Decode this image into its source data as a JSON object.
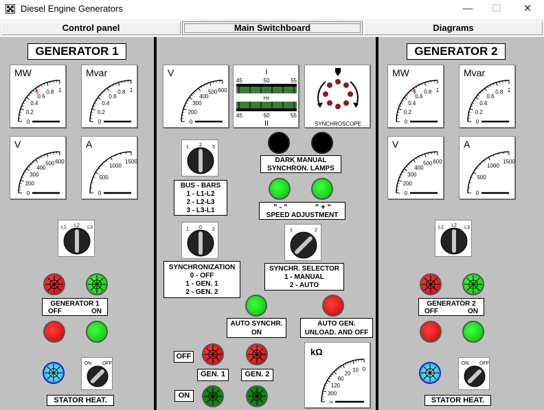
{
  "window": {
    "title": "Diesel Engine Generators",
    "minimize": "—",
    "maximize": "☐",
    "close": "✕"
  },
  "tabs": [
    {
      "label": "Control panel"
    },
    {
      "label": "Main Switchboard"
    },
    {
      "label": "Diagrams"
    }
  ],
  "gen1": {
    "title": "GENERATOR 1",
    "mw": {
      "unit": "MW",
      "ticks": [
        "0",
        "0.2",
        "0.4",
        "0.6",
        "0.8",
        "1"
      ]
    },
    "mvar": {
      "unit": "Mvar",
      "ticks": [
        "0",
        "0.2",
        "0.4",
        "0.6",
        "0.8",
        "1"
      ]
    },
    "volt": {
      "unit": "V",
      "ticks": [
        "0",
        "200",
        "300",
        "400",
        "500",
        "600"
      ]
    },
    "amp": {
      "unit": "A",
      "ticks": [
        "0",
        "500",
        "1000",
        "1500"
      ]
    },
    "phase_selector": {
      "l1": "L1",
      "l2": "L2",
      "l3": "L3"
    },
    "switch_label": {
      "name": "GENERATOR 1",
      "off": "OFF",
      "on": "ON"
    },
    "heater": {
      "on": "ON",
      "off": "OFF",
      "label": "STATOR  HEAT."
    }
  },
  "gen2": {
    "title": "GENERATOR 2",
    "mw": {
      "unit": "MW",
      "ticks": [
        "0",
        "0.2",
        "0.4",
        "0.6",
        "0.8",
        "1"
      ]
    },
    "mvar": {
      "unit": "Mvar",
      "ticks": [
        "0",
        "0.2",
        "0.4",
        "0.6",
        "0.8",
        "1"
      ]
    },
    "volt": {
      "unit": "V",
      "ticks": [
        "0",
        "200",
        "300",
        "400",
        "500",
        "600"
      ]
    },
    "amp": {
      "unit": "A",
      "ticks": [
        "0",
        "500",
        "1000",
        "1500"
      ]
    },
    "phase_selector": {
      "l1": "L1",
      "l2": "L2",
      "l3": "L3"
    },
    "switch_label": {
      "name": "GENERATOR 2",
      "off": "OFF",
      "on": "ON"
    },
    "heater": {
      "on": "ON",
      "off": "OFF",
      "label": "STATOR  HEAT."
    }
  },
  "center": {
    "volt": {
      "unit": "V",
      "ticks": [
        "0",
        "200",
        "300",
        "400",
        "500",
        "600"
      ]
    },
    "hz": {
      "top_label": "I",
      "bottom_label": "II",
      "unit": "Hz",
      "ticks": [
        "45",
        "50",
        "55"
      ]
    },
    "synchroscope": {
      "label": "SYNCHROSCOPE"
    },
    "dark_lamps_label": [
      "DARK MANUAL",
      "SYNCHRON. LAMPS"
    ],
    "busbar_selector": {
      "pos1": "1",
      "pos2": "2",
      "pos3": "3"
    },
    "busbar_label": [
      "BUS - BARS",
      "1 -  L1-L2",
      "2 -  L2-L3",
      "3 -  L3-L1"
    ],
    "speed_adj": {
      "minus": "\" - \"",
      "plus": "\" + \"",
      "label": "SPEED ADJUSTMENT"
    },
    "sync_selector": {
      "pos0": "0",
      "pos1": "1",
      "pos2": "2"
    },
    "sync_label": [
      "SYNCHRONIZATION",
      "0 - OFF",
      "1 - GEN. 1",
      "2 - GEN. 2"
    ],
    "synchr_sel_knob": {
      "pos1": "1",
      "pos2": "2"
    },
    "synchr_sel_label": [
      "SYNCHR. SELECTOR",
      "1 - MANUAL",
      "2 - AUTO"
    ],
    "auto_synchr_label": [
      "AUTO SYNCHR.",
      "ON"
    ],
    "auto_gen_label": [
      "AUTO GEN.",
      "UNLOAD. AND OFF"
    ],
    "off_label": "OFF",
    "on_label": "ON",
    "gen1_label": "GEN. 1",
    "gen2_label": "GEN. 2",
    "kohm": {
      "unit": "kΩ",
      "ticks": [
        "∞",
        "300",
        "120",
        "60",
        "20",
        "10",
        "0"
      ]
    }
  },
  "colors": {
    "panel": "#c0c0c0",
    "red": "#e00000",
    "green": "#00d000",
    "needle_red": "#ff6060"
  }
}
